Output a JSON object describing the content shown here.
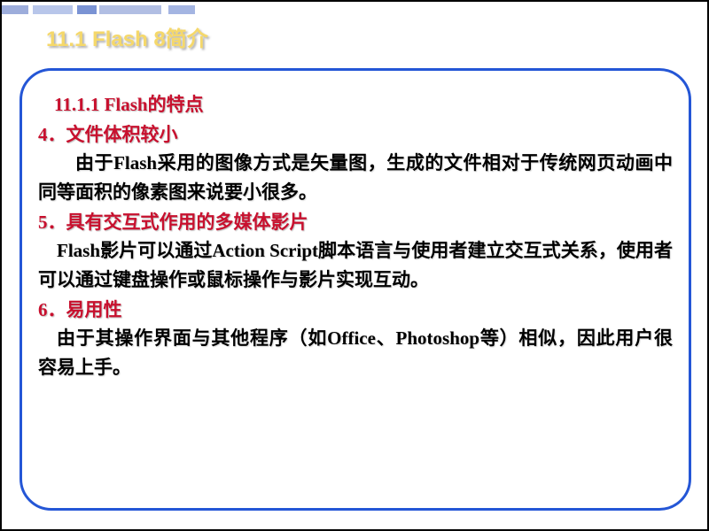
{
  "title": "11.1  Flash 8简介",
  "subtitle": "11.1.1 Flash的特点",
  "sections": [
    {
      "heading": "4．文件体积较小",
      "body": "由于Flash采用的图像方式是矢量图，生成的文件相对于传统网页动画中同等面积的像素图来说要小很多。",
      "indentClass": "indent"
    },
    {
      "heading": "5．具有交互式作用的多媒体影片",
      "body": "Flash影片可以通过Action Script脚本语言与使用者建立交互式关系，使用者可以通过键盘操作或鼠标操作与影片实现互动。",
      "indentClass": "indent-half"
    },
    {
      "heading": "6．易用性",
      "body": "由于其操作界面与其他程序（如Office、Photoshop等）相似，因此用户很容易上手。",
      "indentClass": "indent-half"
    }
  ]
}
